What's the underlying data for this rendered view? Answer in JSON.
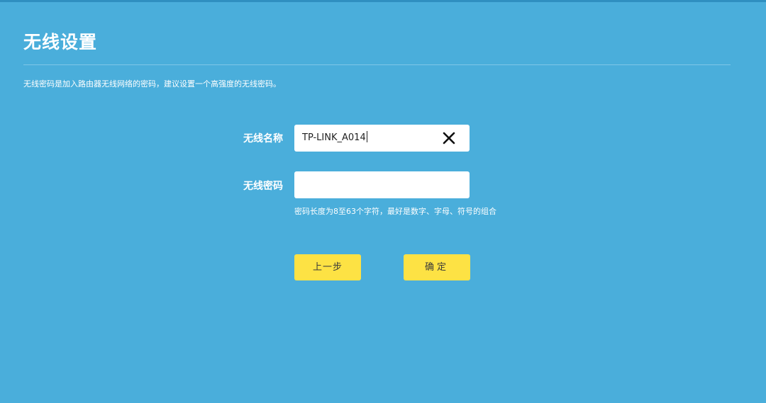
{
  "page": {
    "title": "无线设置",
    "intro": "无线密码是加入路由器无线网络的密码，建议设置一个高强度的无线密码。"
  },
  "form": {
    "ssid_label": "无线名称",
    "ssid_value": "TP-LINK_A014",
    "password_label": "无线密码",
    "password_value": "",
    "password_hint": "密码长度为8至63个字符，最好是数字、字母、符号的组合"
  },
  "buttons": {
    "prev_label": "上一步",
    "confirm_label": "确定"
  },
  "colors": {
    "background": "#4aaedb",
    "button": "#fde244"
  },
  "icons": {
    "clear": "close-icon"
  }
}
